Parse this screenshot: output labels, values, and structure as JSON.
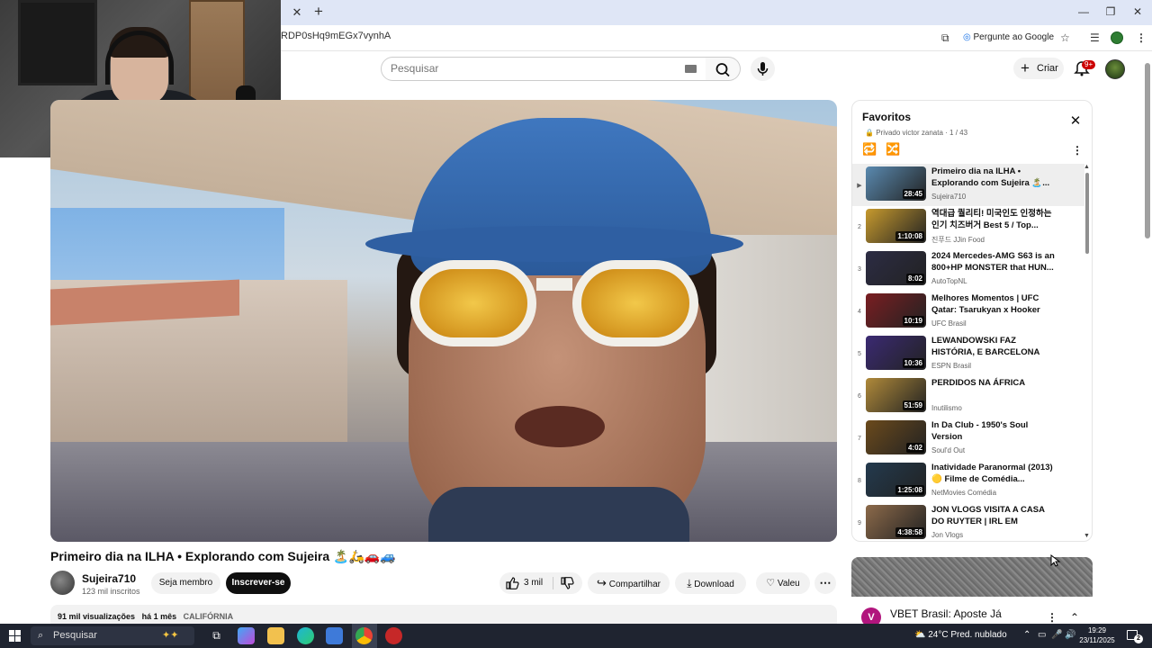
{
  "browser": {
    "url": "RDP0sHq9mEGx7vynhA",
    "ask_google": "Pergunte ao Google"
  },
  "header": {
    "search_placeholder": "Pesquisar",
    "create_label": "Criar",
    "notif_badge": "9+"
  },
  "video": {
    "title": "Primeiro dia na ILHA • Explorando com Sujeira 🏝️🛵🚗🚙",
    "channel": "Sujeira710",
    "subscribers": "123 mil inscritos",
    "member_label": "Seja membro",
    "subscribe_label": "Inscrever-se",
    "likes": "3 mil",
    "share_label": "Compartilhar",
    "download_label": "Download",
    "thanks_label": "Valeu",
    "views": "91 mil visualizações",
    "age": "há 1 mês",
    "location": "CALIFÓRNIA"
  },
  "playlist": {
    "title": "Favoritos",
    "meta": "Privado victor zanata · 1 / 43",
    "items": [
      {
        "index": "▶",
        "title": "Primeiro dia na ILHA • Explorando com Sujeira 🏝️...",
        "channel": "Sujeira710",
        "duration": "28:45",
        "color": "#5a8ab0"
      },
      {
        "index": "2",
        "title": "역대급 퀄리티! 미국인도 인정하는 인기 치즈버거 Best 5 / Top...",
        "channel": "진푸드 JJin Food",
        "duration": "1:10:08",
        "color": "#c79a2e"
      },
      {
        "index": "3",
        "title": "2024 Mercedes-AMG S63 is an 800+HP MONSTER that HUN...",
        "channel": "AutoTopNL",
        "duration": "8:02",
        "color": "#2c2c44"
      },
      {
        "index": "4",
        "title": "Melhores Momentos | UFC Qatar: Tsarukyan x Hooker",
        "channel": "UFC Brasil",
        "duration": "10:19",
        "color": "#7a1e22"
      },
      {
        "index": "5",
        "title": "LEWANDOWSKI FAZ HISTÓRIA, E BARCELONA GOLEIA...",
        "channel": "ESPN Brasil",
        "duration": "10:36",
        "color": "#3b2a73"
      },
      {
        "index": "6",
        "title": "PERDIDOS NA ÁFRICA",
        "channel": "Inutilismo",
        "duration": "51:59",
        "color": "#b08a3a"
      },
      {
        "index": "7",
        "title": "In Da Club - 1950's Soul Version",
        "channel": "Soul'd Out",
        "duration": "4:02",
        "color": "#6b4a1c"
      },
      {
        "index": "8",
        "title": "Inatividade Paranormal (2013) 🟡 Filme de Comédia...",
        "channel": "NetMovies Comédia",
        "duration": "1:25:08",
        "color": "#233a4e"
      },
      {
        "index": "9",
        "title": "JON VLOGS VISITA A CASA DO RUYTER | IRL EM PORTUGAL",
        "channel": "Jon Vlogs",
        "duration": "4:38:58",
        "color": "#8c6a4a"
      }
    ]
  },
  "ad": {
    "title": "VBET Brasil: Aposte Já"
  },
  "taskbar": {
    "search_label": "Pesquisar",
    "weather": "24°C  Pred. nublado",
    "time": "19:29",
    "date": "23/11/2025",
    "notif_count": "2"
  }
}
